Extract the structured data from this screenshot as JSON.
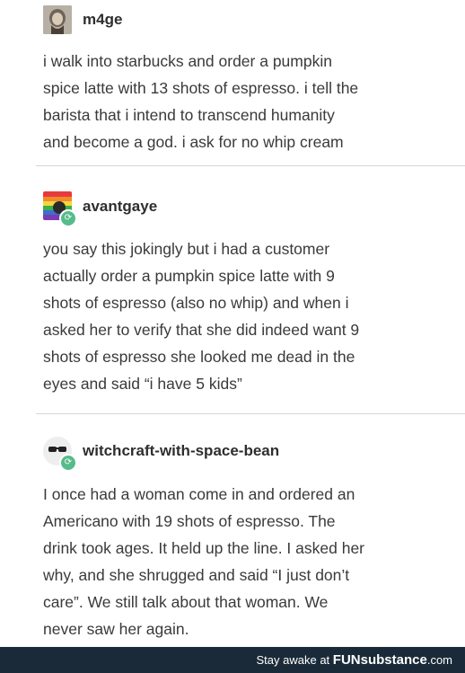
{
  "posts": [
    {
      "username": "m4ge",
      "text": "i walk into starbucks and order a pumpkin\nspice latte with 13 shots of espresso. i tell the\nbarista that i intend to transcend humanity\nand become a god. i ask for no whip cream",
      "reblog": false
    },
    {
      "username": "avantgaye",
      "text": "you say this jokingly but i had a customer\nactually order a pumpkin spice latte with 9\nshots of espresso (also no whip) and when i\nasked her to verify that she did indeed want 9\nshots of espresso she looked me dead in the\neyes and said “i have 5 kids”",
      "reblog": true
    },
    {
      "username": "witchcraft-with-space-bean",
      "text": "I once had a woman come in and ordered an\nAmericano with 19 shots of espresso. The\ndrink took ages. It held up the line. I asked her\nwhy, and she shrugged and said “I just don’t\ncare”. We still talk about that woman. We\nnever saw her again.",
      "reblog": true
    }
  ],
  "footer": {
    "prefix": "Stay awake at ",
    "brand_fun": "FUN",
    "brand_sub": "substance",
    "brand_suffix": ".com"
  },
  "colors": {
    "reblog_badge": "#56bc8a",
    "footer_bg": "#1a2a38"
  }
}
